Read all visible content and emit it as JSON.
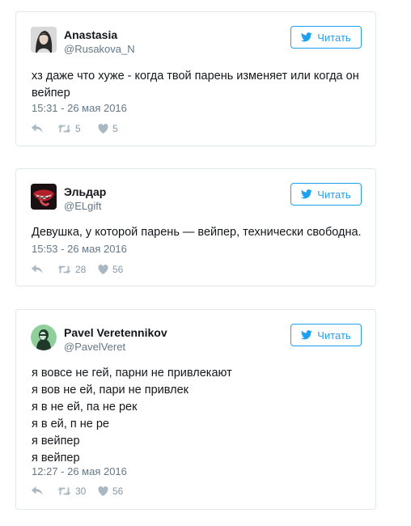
{
  "follow_label": "Читать",
  "tweets": [
    {
      "name": "Anastasia",
      "handle": "@Rusakova_N",
      "lines": [
        "хз даже что хуже - когда твой парень изменяет или когда он",
        "вейпер"
      ],
      "time": "15:31 - 26 мая 2016",
      "retweets": "5",
      "likes": "5"
    },
    {
      "name": "Эльдар",
      "handle": "@ELgift",
      "lines": [
        "Девушка, у которой парень — вейпер, технически свободна."
      ],
      "time": "15:53 - 26 мая 2016",
      "retweets": "28",
      "likes": "56"
    },
    {
      "name": "Pavel Veretennikov",
      "handle": "@PavelVeret",
      "lines": [
        "я вовсе не гей, парни не привлекают",
        "я вов не ей, пари не привлек",
        "я в не ей, па не рек",
        "я в ей, п не ре",
        "я вейпер",
        "я вейпер"
      ],
      "time": "12:27 - 26 мая 2016",
      "retweets": "30",
      "likes": "56"
    }
  ],
  "icons": {
    "follow": "twitter-bird-icon",
    "reply": "reply-icon",
    "retweet": "retweet-icon",
    "like": "heart-icon"
  },
  "colors": {
    "accent": "#1da1f2",
    "border": "#e1e8ed",
    "muted": "#657786",
    "action": "#aab8c2"
  }
}
